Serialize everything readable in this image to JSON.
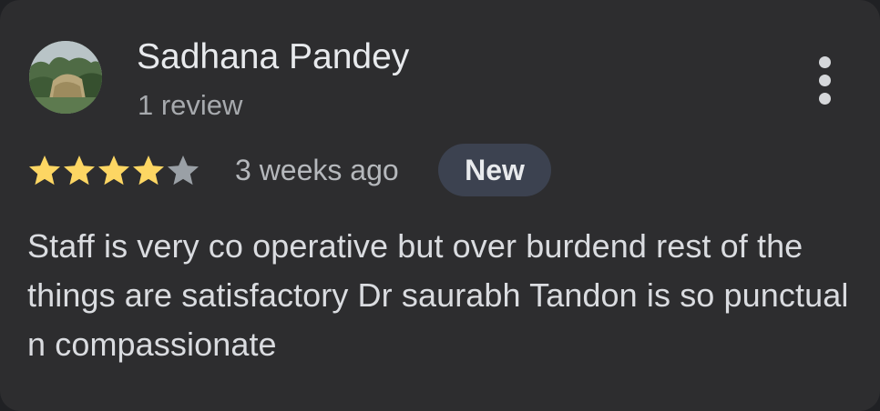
{
  "review": {
    "reviewer_name": "Sadhana Pandey",
    "review_count": "1 review",
    "rating": 4,
    "rating_max": 5,
    "time_ago": "3 weeks ago",
    "badge": "New",
    "text": "Staff is very co operative but over burdend rest of the things are satisfactory Dr saurabh Tandon is so punctual n compassionate"
  },
  "icons": {
    "more": "more-vert-icon",
    "star_filled": "star-filled-icon",
    "star_empty": "star-empty-icon",
    "avatar": "profile-photo"
  },
  "colors": {
    "card_background": "#2d2d2f",
    "star_filled": "#fdd663",
    "star_empty": "#9aa0a6",
    "badge_background": "#3c4250",
    "secondary_text": "#a7aaae"
  }
}
